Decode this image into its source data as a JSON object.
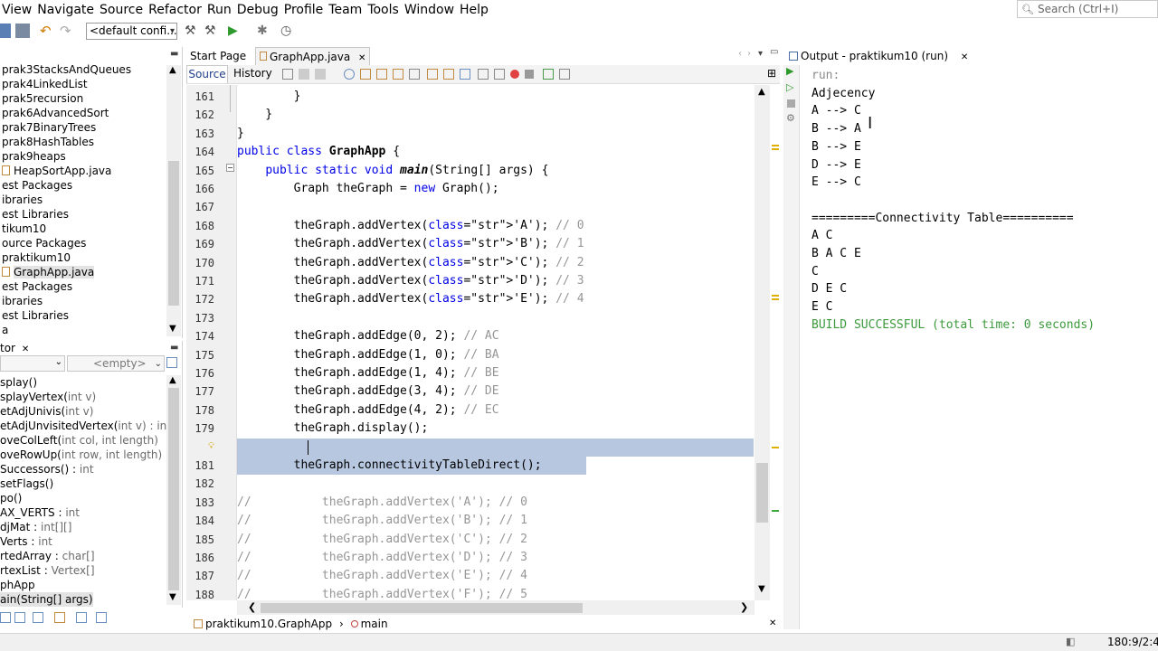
{
  "menu": [
    "View",
    "Navigate",
    "Source",
    "Refactor",
    "Run",
    "Debug",
    "Profile",
    "Team",
    "Tools",
    "Window",
    "Help"
  ],
  "search_placeholder": "Search (Ctrl+I)",
  "config_select": "<default confi...",
  "projects": [
    "prak3StacksAndQueues",
    "prak4LinkedList",
    "prak5recursion",
    "prak6AdvancedSort",
    "prak7BinaryTrees",
    "prak8HashTables",
    "prak9heaps",
    "HeapSortApp.java",
    "est Packages",
    "ibraries",
    "est Libraries",
    "tikum10",
    "ource Packages",
    "praktikum10",
    "GraphApp.java",
    "est Packages",
    "ibraries",
    "est Libraries",
    "a"
  ],
  "navigator": {
    "tab": "tor",
    "filter_left": "",
    "filter_right": "<empty>",
    "members": [
      {
        "name": "splay()",
        "sig": ""
      },
      {
        "name": "splayVertex(",
        "sig": "int v)"
      },
      {
        "name": "etAdjUnivis(",
        "sig": "int v)"
      },
      {
        "name": "etAdjUnvisitedVertex(",
        "sig": "int v) : int"
      },
      {
        "name": "oveColLeft(",
        "sig": "int col, int length)"
      },
      {
        "name": "oveRowUp(",
        "sig": "int row, int length)"
      },
      {
        "name": "Successors() : ",
        "sig": "int"
      },
      {
        "name": "setFlags()",
        "sig": ""
      },
      {
        "name": "po()",
        "sig": ""
      },
      {
        "name": "AX_VERTS : ",
        "sig": "int"
      },
      {
        "name": "djMat : ",
        "sig": "int[][]"
      },
      {
        "name": "Verts : ",
        "sig": "int"
      },
      {
        "name": "rtedArray : ",
        "sig": "char[]"
      },
      {
        "name": "rtexList : ",
        "sig": "Vertex[]"
      },
      {
        "name": "phApp",
        "sig": ""
      },
      {
        "name": "ain(String[] args)",
        "sig": ""
      }
    ]
  },
  "editor": {
    "tabs": [
      "Start Page",
      "GraphApp.java"
    ],
    "source_tab": "Source",
    "history_tab": "History",
    "lines": [
      {
        "n": "161",
        "html": "        }"
      },
      {
        "n": "162",
        "html": "    }"
      },
      {
        "n": "163",
        "html": "}"
      },
      {
        "n": "164",
        "html": "public class GraphApp {"
      },
      {
        "n": "165",
        "html": "    public static void main(String[] args) {"
      },
      {
        "n": "166",
        "html": "        Graph theGraph = new Graph();"
      },
      {
        "n": "167",
        "html": ""
      },
      {
        "n": "168",
        "html": "        theGraph.addVertex('A'); // 0"
      },
      {
        "n": "169",
        "html": "        theGraph.addVertex('B'); // 1"
      },
      {
        "n": "170",
        "html": "        theGraph.addVertex('C'); // 2"
      },
      {
        "n": "171",
        "html": "        theGraph.addVertex('D'); // 3"
      },
      {
        "n": "172",
        "html": "        theGraph.addVertex('E'); // 4"
      },
      {
        "n": "173",
        "html": ""
      },
      {
        "n": "174",
        "html": "        theGraph.addEdge(0, 2); // AC"
      },
      {
        "n": "175",
        "html": "        theGraph.addEdge(1, 0); // BA"
      },
      {
        "n": "176",
        "html": "        theGraph.addEdge(1, 4); // BE"
      },
      {
        "n": "177",
        "html": "        theGraph.addEdge(3, 4); // DE"
      },
      {
        "n": "178",
        "html": "        theGraph.addEdge(4, 2); // EC"
      },
      {
        "n": "179",
        "html": "        theGraph.display();"
      },
      {
        "n": "",
        "html": ""
      },
      {
        "n": "181",
        "html": "        theGraph.connectivityTableDirect();"
      },
      {
        "n": "182",
        "html": ""
      },
      {
        "n": "183",
        "html": "//          theGraph.addVertex('A'); // 0"
      },
      {
        "n": "184",
        "html": "//          theGraph.addVertex('B'); // 1"
      },
      {
        "n": "185",
        "html": "//          theGraph.addVertex('C'); // 2"
      },
      {
        "n": "186",
        "html": "//          theGraph.addVertex('D'); // 3"
      },
      {
        "n": "187",
        "html": "//          theGraph.addVertex('E'); // 4"
      },
      {
        "n": "188",
        "html": "//          theGraph.addVertex('F'); // 5"
      }
    ],
    "breadcrumb": [
      "praktikum10.GraphApp",
      "main"
    ]
  },
  "output": {
    "tab": "Output - praktikum10 (run)",
    "lines": [
      {
        "t": "run:",
        "c": "grey"
      },
      {
        "t": "Adjecency",
        "c": "black"
      },
      {
        "t": "A --> C",
        "c": "black"
      },
      {
        "t": "B --> A",
        "c": "black"
      },
      {
        "t": "B --> E",
        "c": "black"
      },
      {
        "t": "D --> E",
        "c": "black"
      },
      {
        "t": "E --> C",
        "c": "black"
      },
      {
        "t": "",
        "c": "black"
      },
      {
        "t": "=========Connectivity Table==========",
        "c": "black"
      },
      {
        "t": "A C",
        "c": "black"
      },
      {
        "t": "B A C E",
        "c": "black"
      },
      {
        "t": "C",
        "c": "black"
      },
      {
        "t": "D E C",
        "c": "black"
      },
      {
        "t": "E C",
        "c": "black"
      },
      {
        "t": "BUILD SUCCESSFUL (total time: 0 seconds)",
        "c": "green"
      }
    ]
  },
  "status": {
    "position": "180:9/2:44"
  },
  "colors": {
    "keyword": "#0000e6",
    "comment": "#969696",
    "string": "#ce7b00",
    "selection": "#b6c7df",
    "build_ok": "#3c9a3c"
  }
}
